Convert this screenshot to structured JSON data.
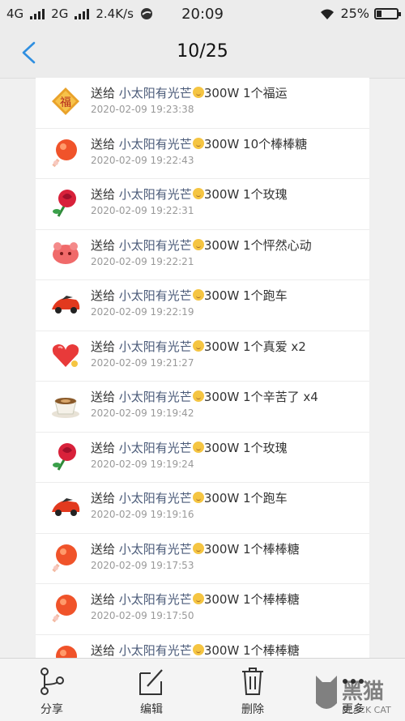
{
  "status_bar": {
    "network1": "4G",
    "network2": "2G",
    "speed": "2.4K/s",
    "time": "20:09",
    "battery": "25%",
    "battery_level": 0.25
  },
  "header": {
    "title": "10/25"
  },
  "gifts": [
    {
      "prefix": "送给",
      "user": "小太阳有光芒",
      "suffix": "300W 1个福运",
      "time": "2020-02-09 19:23:38",
      "icon": "fortune-gift-icon"
    },
    {
      "prefix": "送给",
      "user": "小太阳有光芒",
      "suffix": "300W 10个棒棒糖",
      "time": "2020-02-09 19:22:43",
      "icon": "lollipop-gift-icon"
    },
    {
      "prefix": "送给",
      "user": "小太阳有光芒",
      "suffix": "300W 1个玫瑰",
      "time": "2020-02-09 19:22:31",
      "icon": "rose-gift-icon"
    },
    {
      "prefix": "送给",
      "user": "小太阳有光芒",
      "suffix": "300W 1个怦然心动",
      "time": "2020-02-09 19:22:21",
      "icon": "heartbeat-gift-icon"
    },
    {
      "prefix": "送给",
      "user": "小太阳有光芒",
      "suffix": "300W 1个跑车",
      "time": "2020-02-09 19:22:19",
      "icon": "sports-car-gift-icon"
    },
    {
      "prefix": "送给",
      "user": "小太阳有光芒",
      "suffix": "300W 1个真爱 x2",
      "time": "2020-02-09 19:21:27",
      "icon": "true-love-gift-icon"
    },
    {
      "prefix": "送给",
      "user": "小太阳有光芒",
      "suffix": "300W 1个辛苦了 x4",
      "time": "2020-02-09 19:19:42",
      "icon": "coffee-gift-icon"
    },
    {
      "prefix": "送给",
      "user": "小太阳有光芒",
      "suffix": "300W 1个玫瑰",
      "time": "2020-02-09 19:19:24",
      "icon": "rose-gift-icon"
    },
    {
      "prefix": "送给",
      "user": "小太阳有光芒",
      "suffix": "300W 1个跑车",
      "time": "2020-02-09 19:19:16",
      "icon": "sports-car-gift-icon"
    },
    {
      "prefix": "送给",
      "user": "小太阳有光芒",
      "suffix": "300W 1个棒棒糖",
      "time": "2020-02-09 19:17:53",
      "icon": "lollipop-gift-icon"
    },
    {
      "prefix": "送给",
      "user": "小太阳有光芒",
      "suffix": "300W 1个棒棒糖",
      "time": "2020-02-09 19:17:50",
      "icon": "lollipop-gift-icon"
    },
    {
      "prefix": "送给",
      "user": "小太阳有光芒",
      "suffix": "300W 1个棒棒糖",
      "time": "",
      "icon": "lollipop-gift-icon"
    }
  ],
  "toolbar": {
    "share": "分享",
    "edit": "编辑",
    "delete": "删除",
    "more": "更多"
  },
  "watermark": {
    "text": "黑猫",
    "sub": "BLACK CAT"
  },
  "colors": {
    "accent": "#2f8fe0",
    "username": "#4a5a78"
  }
}
